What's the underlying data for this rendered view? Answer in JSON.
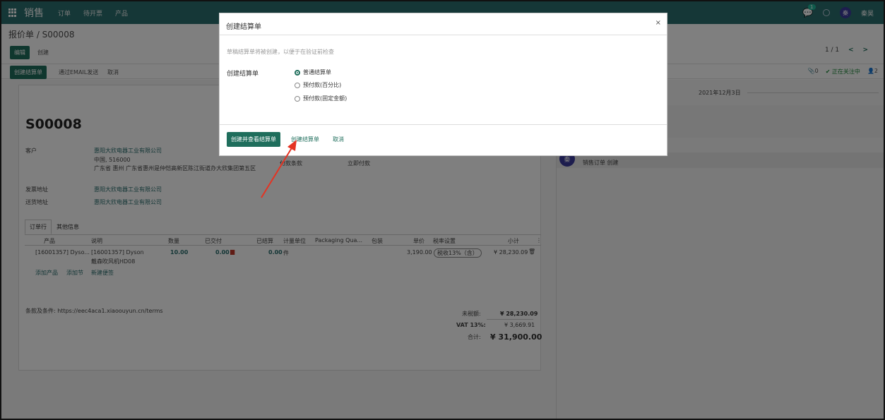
{
  "navbar": {
    "brand": "销售",
    "menu": [
      "订单",
      "待开票",
      "产品"
    ],
    "chat_badge": "1",
    "user_initial": "秦",
    "user_name": "秦昊"
  },
  "control": {
    "breadcrumb": "报价单 / S00008",
    "edit_label": "编辑",
    "create_label": "创建",
    "pager": "1 / 1",
    "pager_prev": "<",
    "pager_next": ">"
  },
  "statusbar": {
    "create_invoice": "创建结算单",
    "send_email": "通过EMAIL发送",
    "cancel": "取消",
    "attachments": "0",
    "following": "✔ 正在关注中",
    "followers": "2"
  },
  "form": {
    "order_name": "S00008",
    "customer_label": "客户",
    "customer": "惠阳大欣电器工业有限公司",
    "address_line1": "中国, 516000",
    "address_line2": "广东省 惠州 广东省惠州是仲恺高新区陈江街道办大欣集团第五区",
    "invoice_addr_label": "发票地址",
    "invoice_addr": "惠阳大欣电器工业有限公司",
    "delivery_addr_label": "送货地址",
    "delivery_addr": "惠阳大欣电器工业有限公司",
    "payment_terms_label": "付款条款",
    "payment_terms": "立即付款",
    "tabs": [
      "订单行",
      "其他信息"
    ],
    "columns": [
      "产品",
      "说明",
      "数量",
      "已交付",
      "已结算",
      "计量单位",
      "Packaging Qua...",
      "包装",
      "单价",
      "税率设置",
      "小计"
    ],
    "line": {
      "product": "[16001357] Dyso...",
      "desc1": "[16001357] Dyson",
      "desc2": "戴森吹风机HD08",
      "qty": "10.00",
      "delivered": "0.00",
      "invoiced": "0.00",
      "uom": "件",
      "price": "3,190.00",
      "tax": "税收13%（含）",
      "subtotal": "¥ 28,230.09"
    },
    "add_product": "添加产品",
    "add_section": "添加节",
    "add_note": "新建便签",
    "terms": "条款及条件: https://eec4aca1.xiaoouyun.cn/terms",
    "untaxed_label": "未税额:",
    "untaxed": "¥ 28,230.09",
    "vat_label": "VAT 13%:",
    "vat": "¥ 3,669.91",
    "total_label": "合计:",
    "total": "¥ 31,900.00"
  },
  "chatter": {
    "date": "2021年12月3日",
    "avatar_initial": "秦",
    "message": "销售订单 创建"
  },
  "modal": {
    "title": "创建结算单",
    "close": "×",
    "hint": "草稿结算单将被创建，以便于在验证前检查",
    "field_label": "创建结算单",
    "options": [
      "普通结算单",
      "预付款(百分比)",
      "预付款(固定金额)"
    ],
    "selected": 0,
    "btn_create_view": "创建并查看结算单",
    "btn_create": "创建结算单",
    "btn_cancel": "取消"
  },
  "colors": {
    "primary": "#1f6e5c",
    "navbar": "#2a6e6e",
    "arrow": "#e53322"
  }
}
